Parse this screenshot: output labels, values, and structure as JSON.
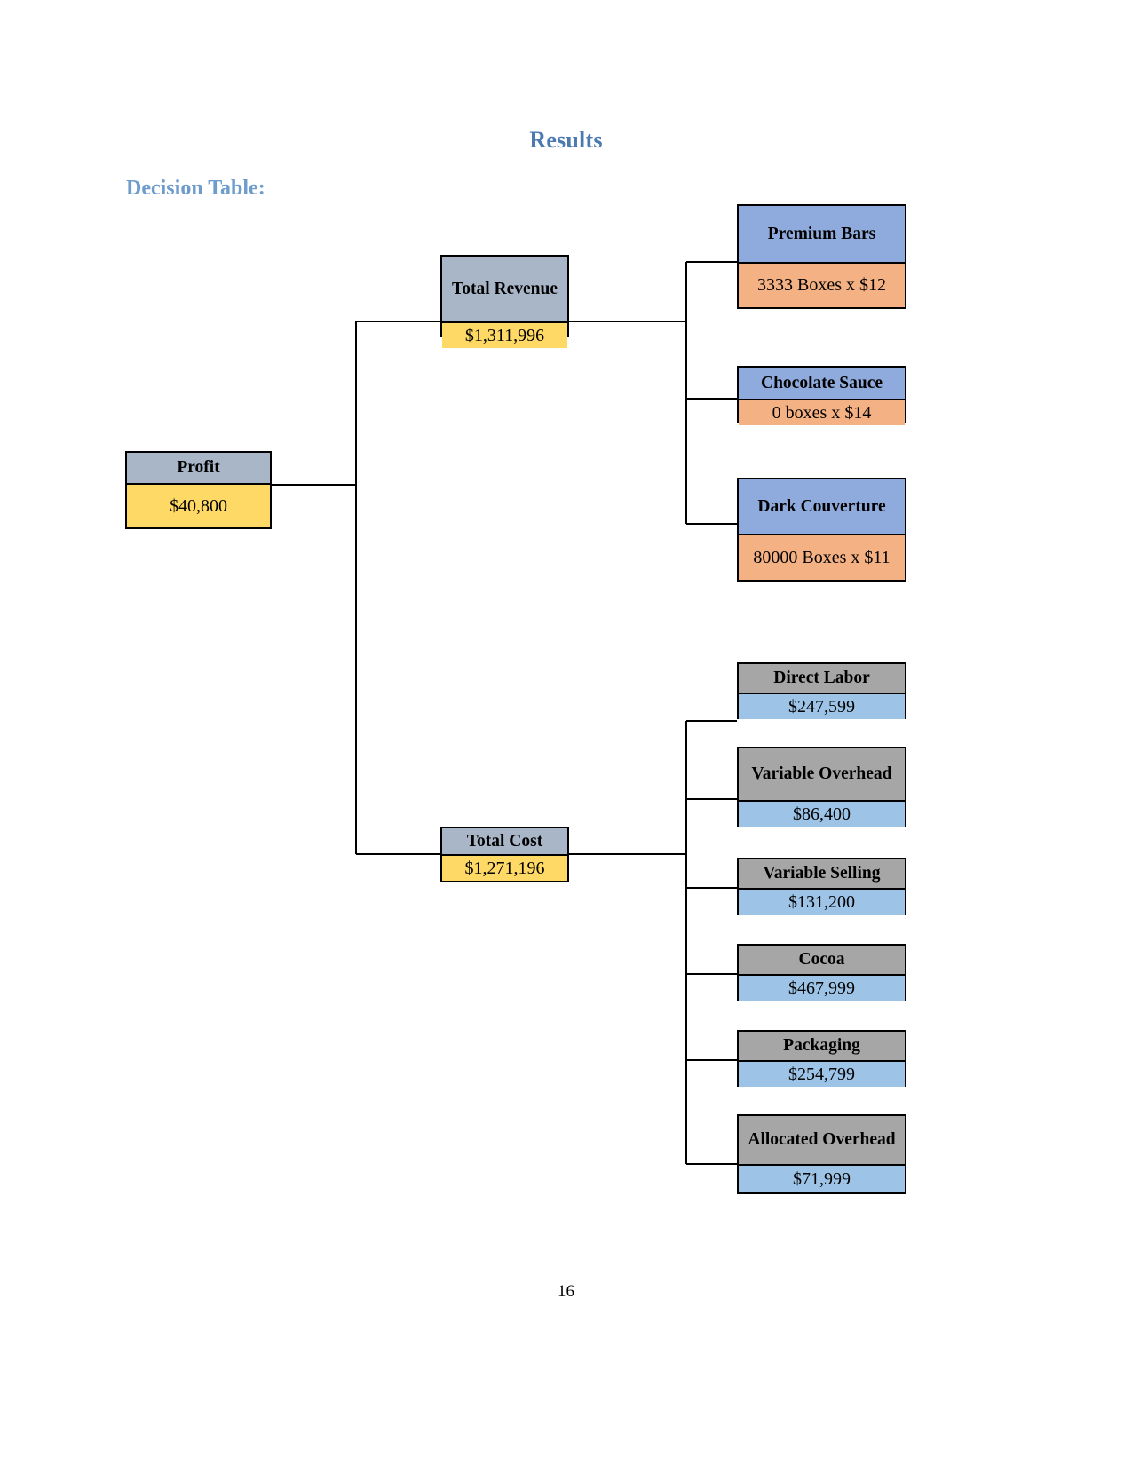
{
  "page": {
    "title": "Results",
    "section_heading": "Decision Table:",
    "page_number": "16"
  },
  "colors": {
    "title_blue": "#4a7ab0",
    "heading_blue": "#6d9ccd",
    "root_header_gray_blue": "#a9b6c8",
    "root_value_yellow": "#ffd966",
    "revenue_header_blue": "#8faadc",
    "revenue_value_orange": "#f4b183",
    "cost_header_gray": "#a6a6a6",
    "cost_value_lightblue": "#9dc3e6",
    "border": "#000000"
  },
  "chart_data": {
    "type": "diagram",
    "title": "Decision Table",
    "root": {
      "label": "Profit",
      "value": "$40,800"
    },
    "branches": [
      {
        "label": "Total Revenue",
        "value": "$1,311,996",
        "children": [
          {
            "label": "Premium Bars",
            "value": "3333 Boxes x $12"
          },
          {
            "label": "Chocolate Sauce",
            "value": "0 boxes x $14"
          },
          {
            "label": "Dark Couverture",
            "value": "80000 Boxes x $11"
          }
        ]
      },
      {
        "label": "Total Cost",
        "value": "$1,271,196",
        "children": [
          {
            "label": "Direct Labor",
            "value": "$247,599"
          },
          {
            "label": "Variable Overhead",
            "value": "$86,400"
          },
          {
            "label": "Variable Selling",
            "value": "$131,200"
          },
          {
            "label": "Cocoa",
            "value": "$467,999"
          },
          {
            "label": "Packaging",
            "value": "$254,799"
          },
          {
            "label": "Allocated Overhead",
            "value": "$71,999"
          }
        ]
      }
    ]
  },
  "nodes": {
    "profit": {
      "label": "Profit",
      "value": "$40,800"
    },
    "total_revenue": {
      "label": "Total Revenue",
      "value": "$1,311,996"
    },
    "total_cost": {
      "label": "Total Cost",
      "value": "$1,271,196"
    },
    "premium_bars": {
      "label": "Premium Bars",
      "value": "3333 Boxes x $12"
    },
    "chocolate_sauce": {
      "label": "Chocolate Sauce",
      "value": "0 boxes x $14"
    },
    "dark_couverture": {
      "label": "Dark Couverture",
      "value": "80000 Boxes x $11"
    },
    "direct_labor": {
      "label": "Direct Labor",
      "value": "$247,599"
    },
    "variable_overhead": {
      "label": "Variable Overhead",
      "value": "$86,400"
    },
    "variable_selling": {
      "label": "Variable Selling",
      "value": "$131,200"
    },
    "cocoa": {
      "label": "Cocoa",
      "value": "$467,999"
    },
    "packaging": {
      "label": "Packaging",
      "value": "$254,799"
    },
    "allocated_overhead": {
      "label": "Allocated Overhead",
      "value": "$71,999"
    }
  }
}
